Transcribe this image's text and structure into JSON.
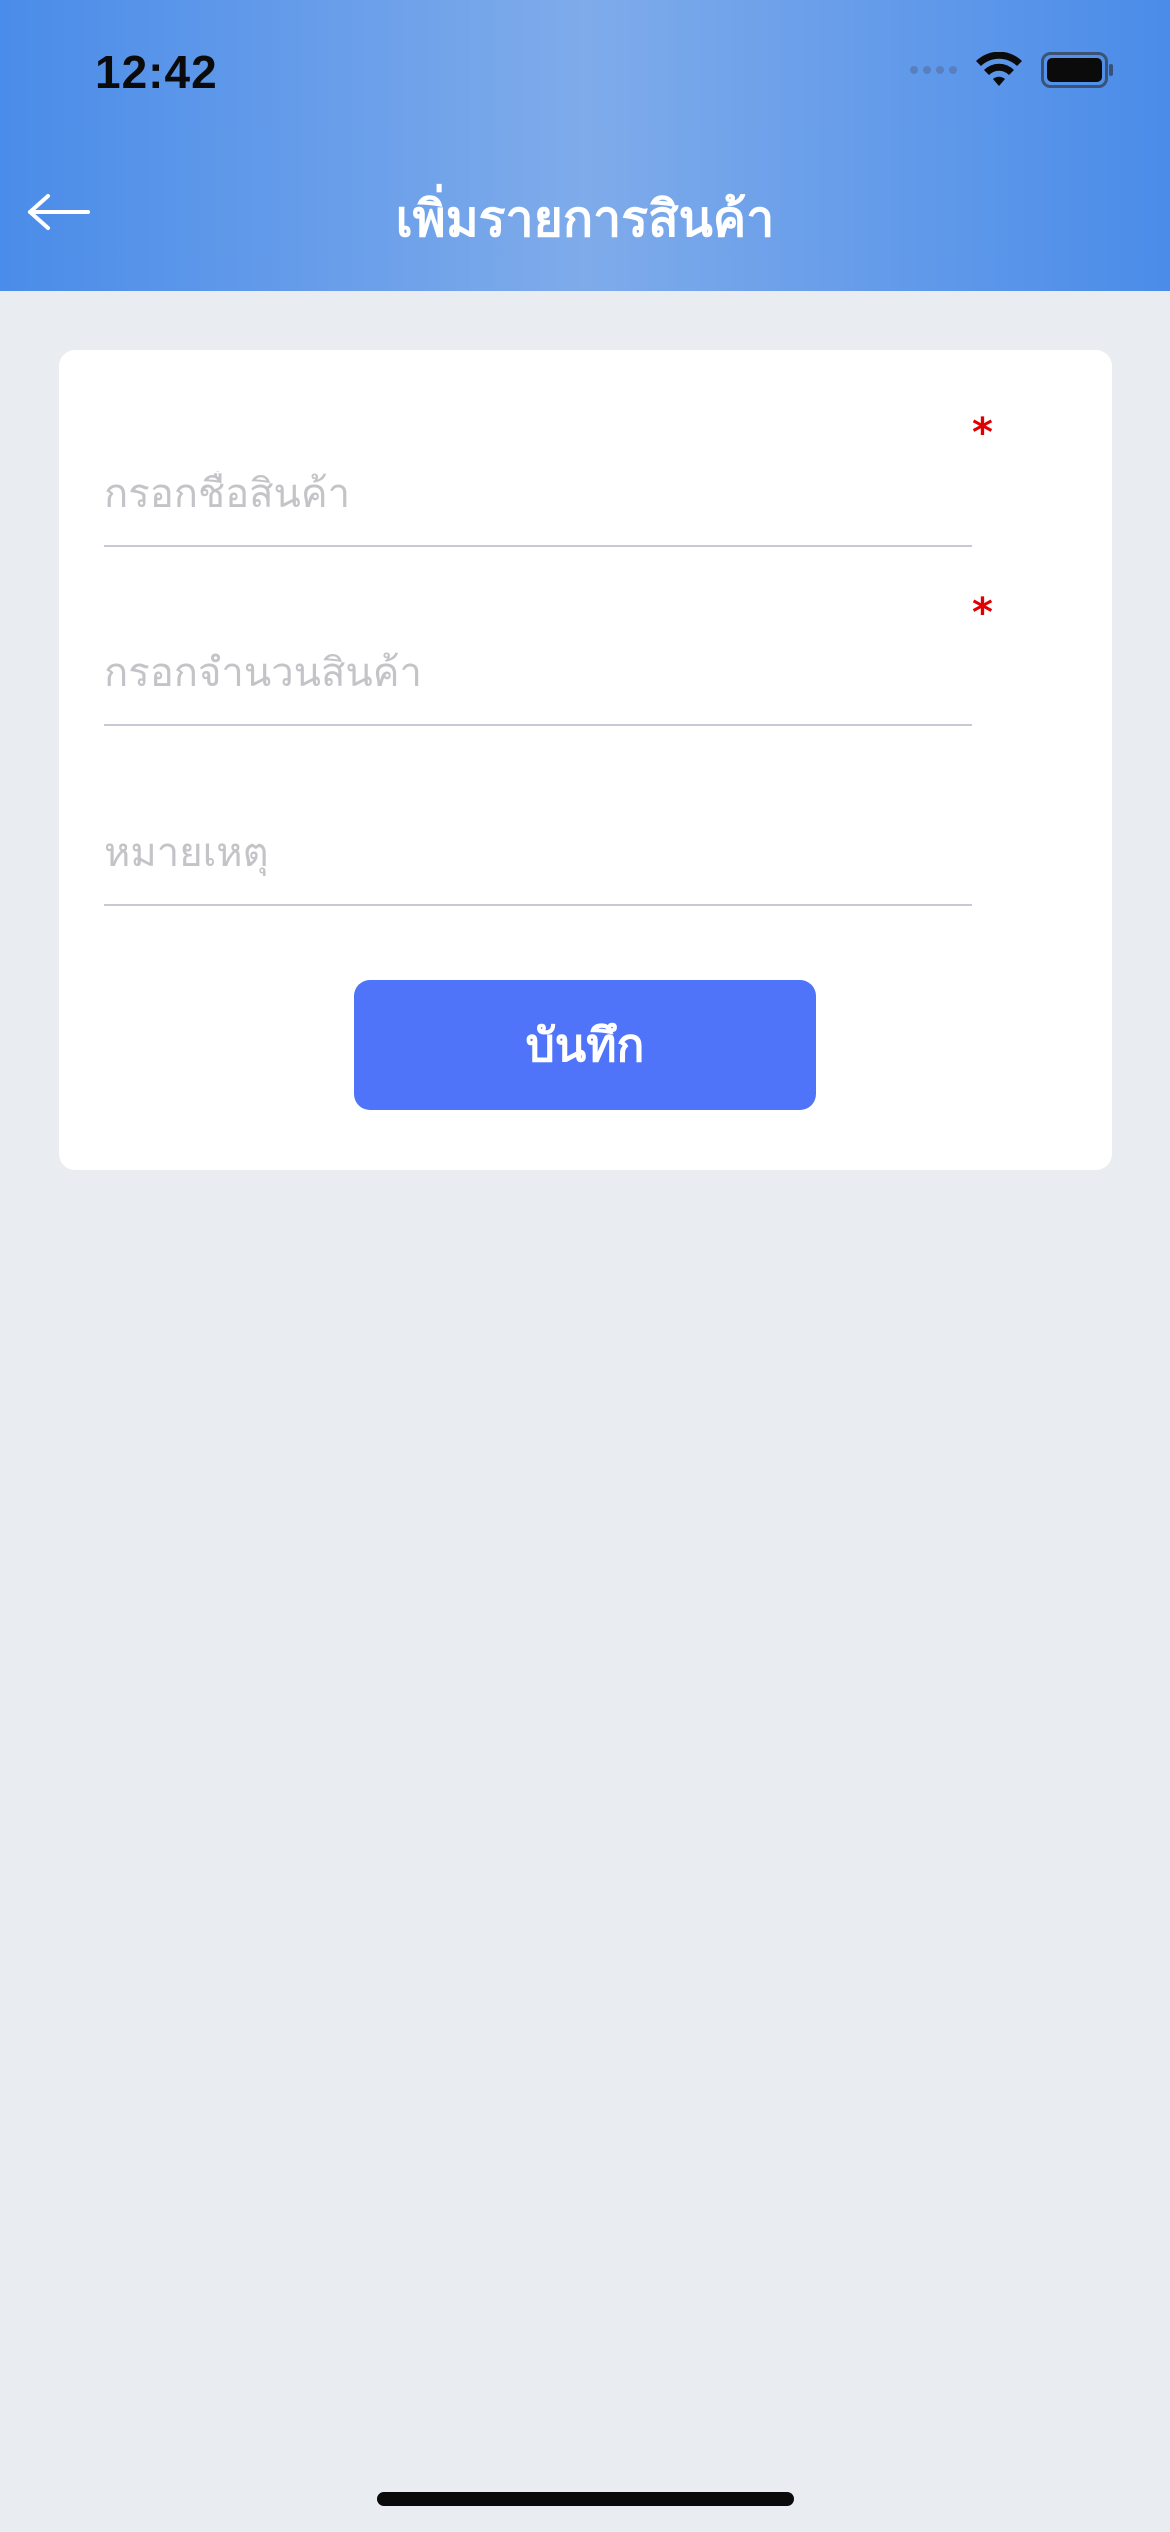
{
  "status_bar": {
    "time": "12:42"
  },
  "header": {
    "title": "เพิ่มรายการสินค้า",
    "back_icon": "arrow-left-icon"
  },
  "form": {
    "product_name": {
      "placeholder": "กรอกชื่อสินค้า",
      "value": "",
      "required_mark": "*"
    },
    "quantity": {
      "placeholder": "กรอกจำนวนสินค้า",
      "value": "",
      "required_mark": "*"
    },
    "note": {
      "placeholder": "หมายเหตุ",
      "value": ""
    },
    "save_label": "บันทึก"
  },
  "colors": {
    "header_gradient_edge": "#4a8ce9",
    "header_gradient_center": "#7fabea",
    "background": "#e9ecf1",
    "primary_button": "#4f74fa",
    "required": "#e00000"
  }
}
